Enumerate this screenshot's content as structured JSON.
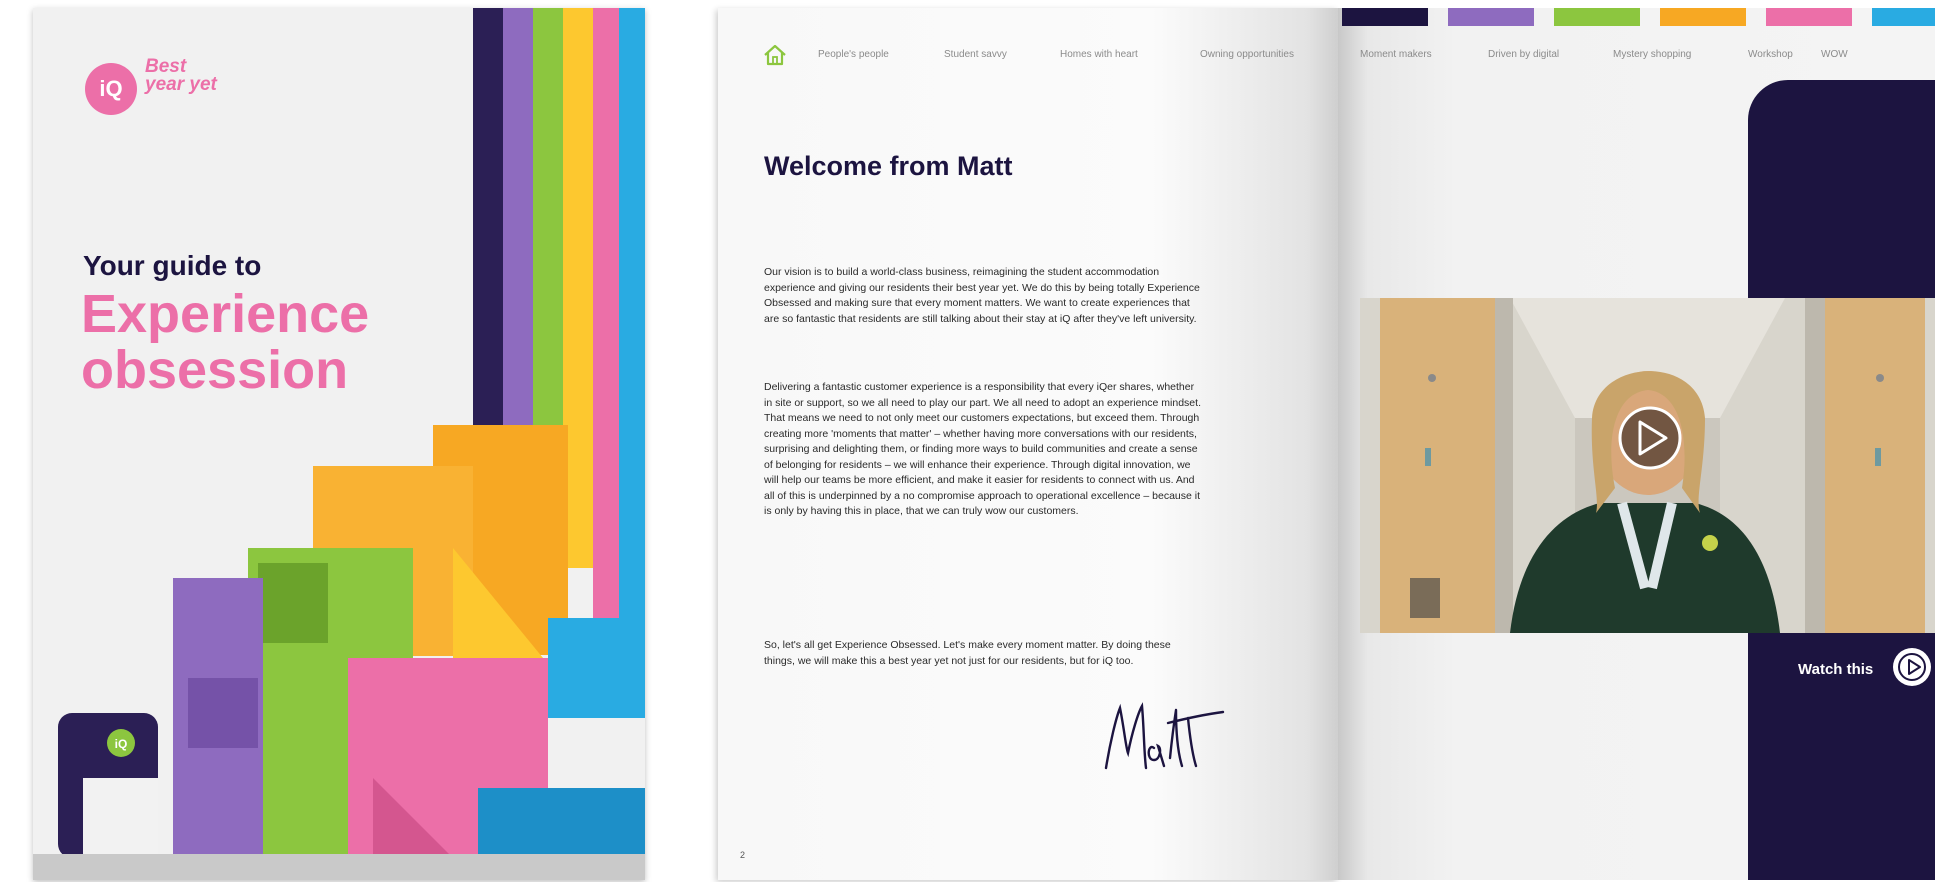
{
  "cover": {
    "logo_mark": "iQ",
    "logo_tagline": "Best year yet",
    "heading_small": "Your guide to",
    "heading_line1": "Experience",
    "heading_line2": "obsession",
    "stripe_colors": [
      "#2b1f55",
      "#8e6bbf",
      "#8cc63f",
      "#fdc82f",
      "#ec6fa8",
      "#29abe2"
    ]
  },
  "nav": {
    "items": [
      "People's people",
      "Student savvy",
      "Homes with heart",
      "Owning opportunities",
      "Moment makers",
      "Driven by digital",
      "Mystery shopping",
      "Workshop",
      "WOW"
    ]
  },
  "left_page": {
    "title": "Welcome from Matt",
    "paragraphs": [
      "Our vision is to build a world-class business, reimagining the student accommodation experience and giving our residents their best year yet. We do this by being totally Experience Obsessed and making sure that every moment matters. We want to create experiences that are so fantastic that residents are still talking about their stay at iQ after they've left university.",
      "Delivering a fantastic customer experience is a responsibility that every iQer shares, whether in site or support, so we all need to play our part. We all need to adopt an experience mindset. That means we need to not only meet our customers expectations, but exceed them. Through creating more 'moments that matter' – whether having more conversations with our residents, surprising and delighting them, or finding more ways to build communities and create a sense of belonging for residents – we will enhance their experience. Through digital innovation, we will help our teams be more efficient, and make it easier for residents to connect with us. And all of this is underpinned by a no compromise approach to operational excellence – because it is only by having this in place, that we can truly wow our customers.",
      "So, let's all get Experience Obsessed. Let's make every moment matter. By doing these things, we will make this a best year yet not just for our residents, but for iQ too."
    ],
    "signature": "Matt",
    "page_number": "2"
  },
  "right_page": {
    "watch_label": "Watch this",
    "swatch_colors": [
      "#1c1440",
      "#8e6bbf",
      "#8cc63f",
      "#f7a823",
      "#ec6fa8",
      "#29abe2"
    ]
  }
}
